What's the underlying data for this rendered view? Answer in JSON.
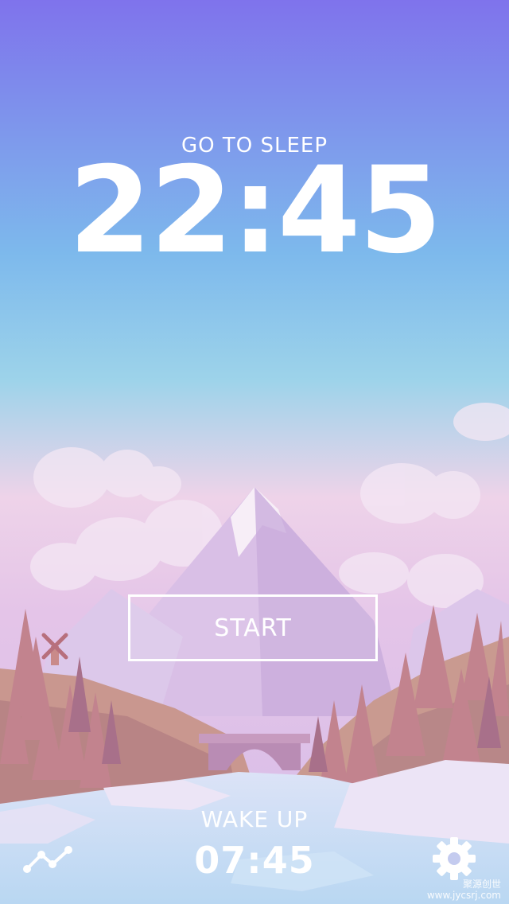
{
  "sleep": {
    "label": "GO TO SLEEP",
    "time": "22:45"
  },
  "action": {
    "start_label": "START"
  },
  "wake": {
    "label": "WAKE UP",
    "time": "07:45"
  },
  "footer": {
    "left_icon": "stats-icon",
    "right_icon": "gear-icon"
  },
  "watermark": {
    "line1": "聚源创世",
    "line2": "www.jycsrj.com"
  },
  "colors": {
    "sky_top": "#7f73ec",
    "sky_mid": "#7dbcea",
    "sky_pink": "#f0cde3",
    "text": "#ffffff"
  }
}
